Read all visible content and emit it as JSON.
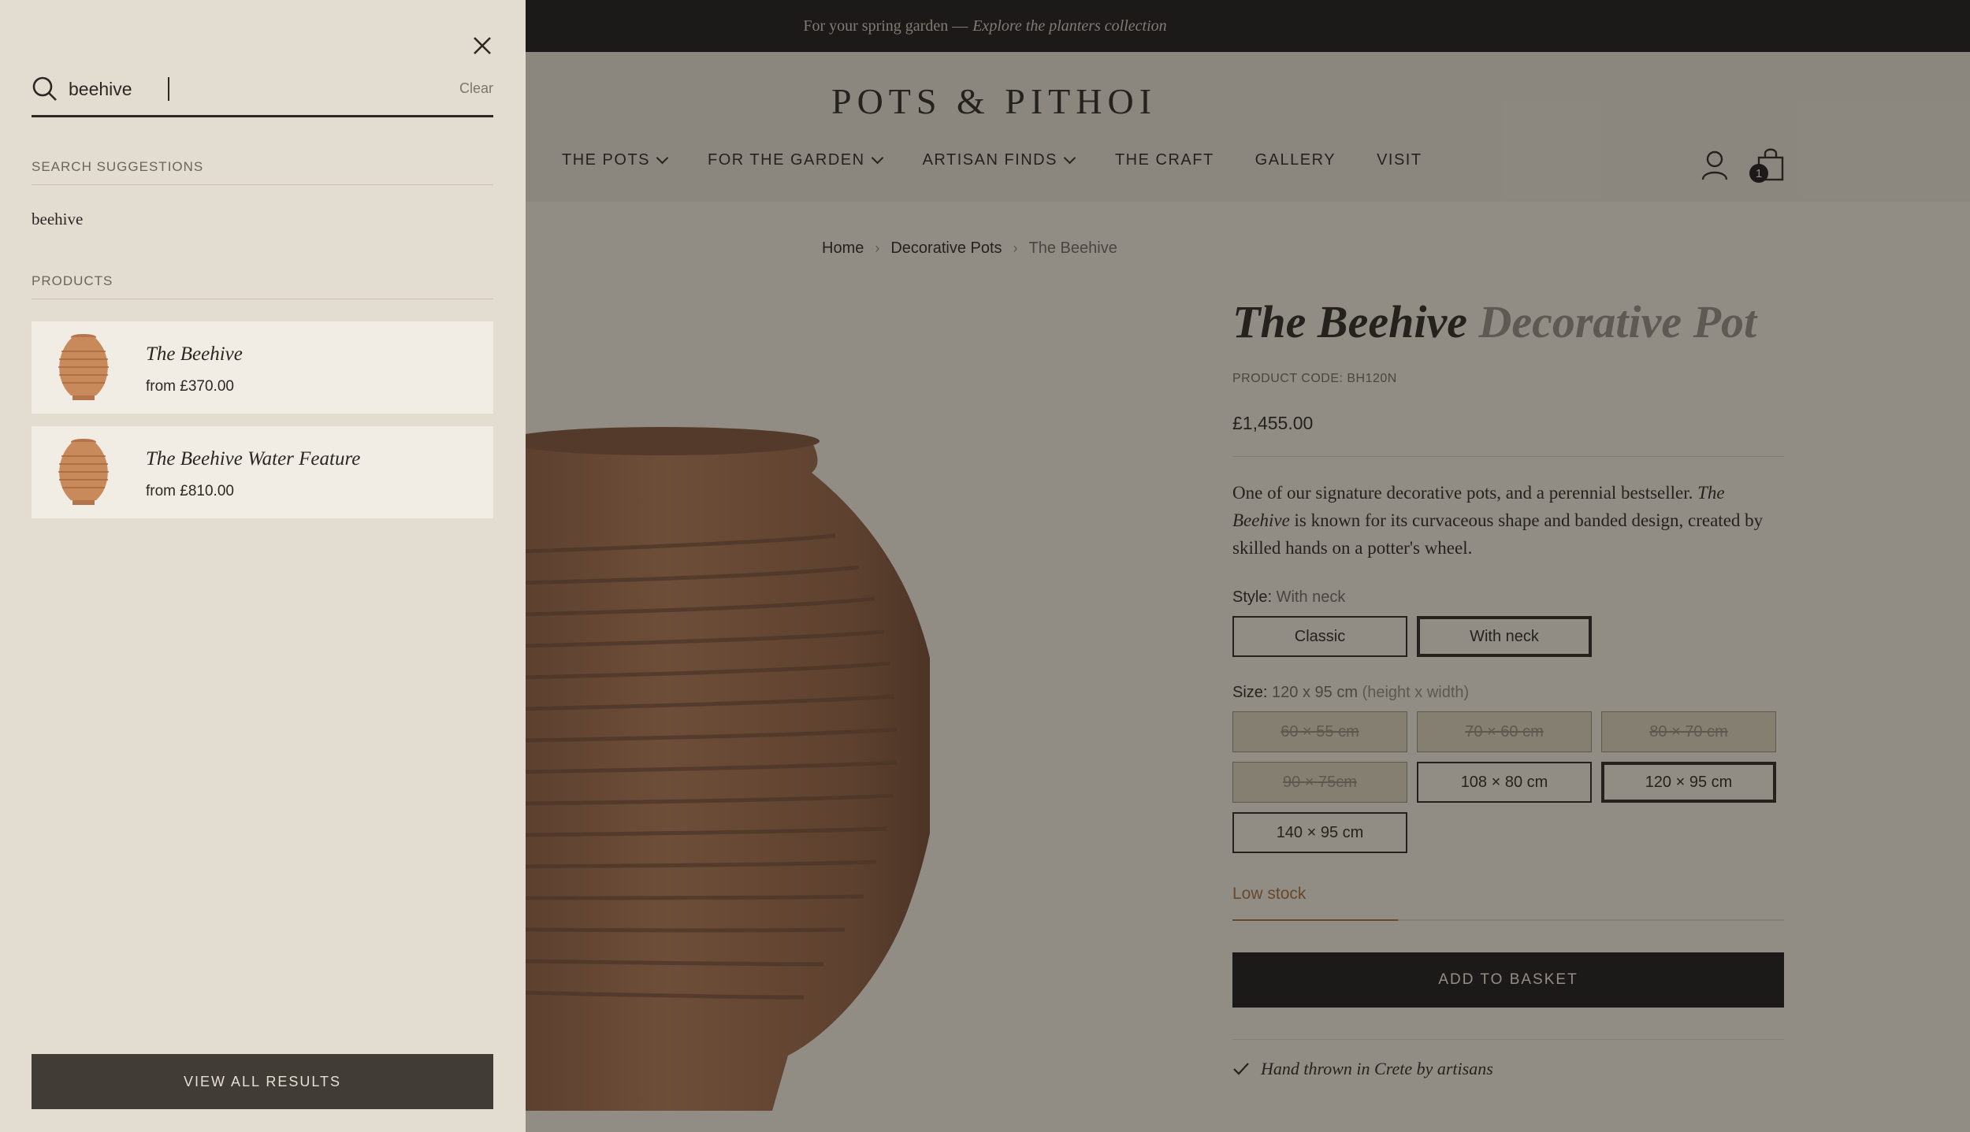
{
  "announcement": {
    "text": "For your spring garden —",
    "link": "Explore the planters collection"
  },
  "header": {
    "logo": "POTS & PITHOI",
    "nav": [
      {
        "label": "THE POTS",
        "dropdown": true
      },
      {
        "label": "FOR THE GARDEN",
        "dropdown": true
      },
      {
        "label": "ARTISAN FINDS",
        "dropdown": true
      },
      {
        "label": "THE CRAFT",
        "dropdown": false
      },
      {
        "label": "GALLERY",
        "dropdown": false
      },
      {
        "label": "VISIT",
        "dropdown": false
      }
    ],
    "cart_count": "1"
  },
  "breadcrumb": {
    "home": "Home",
    "category": "Decorative Pots",
    "current": "The Beehive"
  },
  "product": {
    "title": "The Beehive",
    "title_sub": "Decorative Pot",
    "code": "PRODUCT CODE: BH120N",
    "price": "£1,455.00",
    "description_1": "One of our signature decorative pots, and a perennial bestseller.",
    "description_em": "The Beehive",
    "description_2": "is known for its curvaceous shape and banded design, created by skilled hands on a potter's wheel.",
    "style_label": "Style:",
    "style_value": "With neck",
    "styles": [
      {
        "label": "Classic",
        "selected": false
      },
      {
        "label": "With neck",
        "selected": true
      }
    ],
    "size_label": "Size:",
    "size_value": "120 x 95 cm",
    "size_note": "(height x width)",
    "sizes": [
      {
        "label": "60 × 55 cm",
        "disabled": true,
        "selected": false
      },
      {
        "label": "70 × 60 cm",
        "disabled": true,
        "selected": false
      },
      {
        "label": "80 × 70 cm",
        "disabled": true,
        "selected": false
      },
      {
        "label": "90 × 75cm",
        "disabled": true,
        "selected": false
      },
      {
        "label": "108 × 80 cm",
        "disabled": false,
        "selected": false
      },
      {
        "label": "120 × 95 cm",
        "disabled": false,
        "selected": true
      },
      {
        "label": "140 × 95 cm",
        "disabled": false,
        "selected": false
      }
    ],
    "stock": "Low stock",
    "stock_level": 0.3,
    "add_button": "ADD TO BASKET",
    "feature": "Hand thrown in Crete by artisans"
  },
  "search": {
    "query": "beehive",
    "clear_label": "Clear",
    "suggestions_heading": "SEARCH SUGGESTIONS",
    "suggestions": [
      "beehive"
    ],
    "products_heading": "PRODUCTS",
    "results": [
      {
        "name": "The Beehive",
        "price": "from £370.00"
      },
      {
        "name": "The Beehive Water Feature",
        "price": "from £810.00"
      }
    ],
    "view_all": "VIEW ALL RESULTS"
  },
  "icons": {
    "close": "close-icon",
    "search": "search-icon",
    "account": "user-icon",
    "cart": "shopping-bag-icon",
    "check": "check-icon"
  },
  "colors": {
    "drawer_bg": "#e3ddd1",
    "dark": "#1b1a1a",
    "accent_stock": "#9c6b3b",
    "terracotta": "#c98a5b"
  }
}
